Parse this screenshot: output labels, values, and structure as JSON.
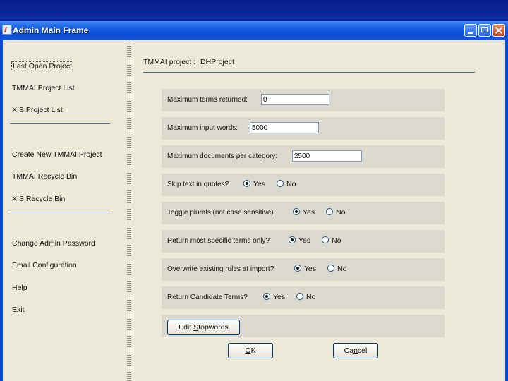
{
  "window": {
    "title": "Admin Main Frame"
  },
  "sidebar": {
    "items": [
      {
        "label": "Last Open Project",
        "selected": true
      },
      {
        "label": "TMMAI Project List"
      },
      {
        "label": "XIS Project List"
      },
      {
        "label": "Create New TMMAI Project"
      },
      {
        "label": "TMMAI Recycle Bin"
      },
      {
        "label": "XIS Recycle Bin"
      },
      {
        "label": "Change Admin Password"
      },
      {
        "label": "Email Configuration"
      },
      {
        "label": "Help"
      },
      {
        "label": "Exit"
      }
    ]
  },
  "project": {
    "label": "TMMAI project :",
    "name": "DHProject"
  },
  "settings": {
    "max_terms": {
      "label": "Maximum terms returned:",
      "value": "0"
    },
    "max_input_words": {
      "label": "Maximum input words:",
      "value": "5000"
    },
    "max_docs_per_category": {
      "label": "Maximum documents per category:",
      "value": "2500"
    },
    "skip_quotes": {
      "label": "Skip text in quotes?",
      "yes": "Yes",
      "no": "No",
      "selected": "yes"
    },
    "toggle_plurals": {
      "label": "Toggle plurals (not case sensitive)",
      "yes": "Yes",
      "no": "No",
      "selected": "yes"
    },
    "specific_terms": {
      "label": "Return most specific terms only?",
      "yes": "Yes",
      "no": "No",
      "selected": "yes"
    },
    "overwrite_rules": {
      "label": "Overwrite existing rules at import?",
      "yes": "Yes",
      "no": "No",
      "selected": "yes"
    },
    "candidate_terms": {
      "label": "Return Candidate Terms?",
      "yes": "Yes",
      "no": "No",
      "selected": "yes"
    }
  },
  "buttons": {
    "edit_stopwords": {
      "pre": "Edit ",
      "mnemonic": "S",
      "post": "topwords"
    },
    "ok": {
      "mnemonic": "O",
      "post": "K"
    },
    "cancel": {
      "pre": "Ca",
      "mnemonic": "n",
      "post": "cel"
    }
  },
  "colors": {
    "titlebar": "#0b4bd6",
    "window_bg": "#ece9d8",
    "row_bg": "#dcd9cf"
  }
}
